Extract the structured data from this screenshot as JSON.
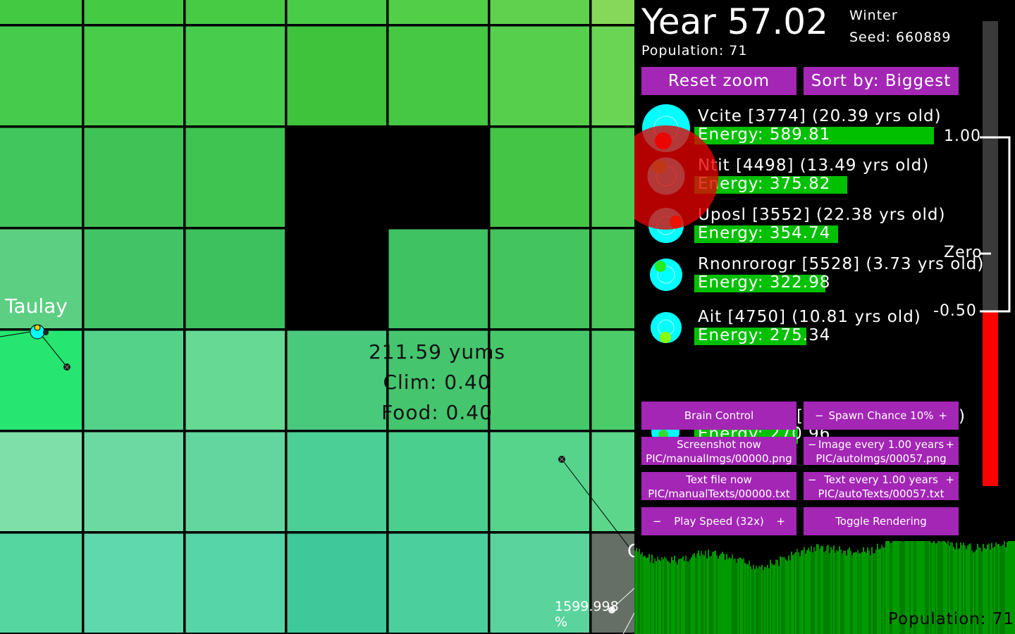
{
  "header": {
    "year_label": "Year 57.02",
    "season": "Winter",
    "seed_label": "Seed: 660889",
    "population_label": "Population: 71"
  },
  "controls": {
    "reset_zoom": "Reset zoom",
    "sort_by": "Sort by: Biggest"
  },
  "creatures": [
    {
      "name_line": "Vcite [3774] (20.39 yrs old)",
      "energy_line": "Energy: 589.81",
      "energy": 589.81,
      "mouth_color": "#ff1a00"
    },
    {
      "name_line": "Ntit [4498] (13.49 yrs old)",
      "energy_line": "Energy: 375.82",
      "energy": 375.82,
      "mouth_color": "#33ff66"
    },
    {
      "name_line": "Uposl [3552] (22.38 yrs old)",
      "energy_line": "Energy: 354.74",
      "energy": 354.74,
      "mouth_color": "#ff5500"
    },
    {
      "name_line": "Rnonrorogr [5528] (3.73 yrs old)",
      "energy_line": "Energy: 322.98",
      "energy": 322.98,
      "mouth_color": "#22ee22"
    },
    {
      "name_line": "Ait [4750] (10.81 yrs old)",
      "energy_line": "Energy: 275.34",
      "energy": 275.34,
      "mouth_color": "#88ff00"
    }
  ],
  "hidden_row": {
    "name_fragment": "[5",
    "name_tail": ")",
    "energy_line": "Energy: 270.96"
  },
  "buttons": {
    "brain_control": "Brain Control",
    "spawn_minus": "−",
    "spawn_label": "Spawn Chance 10%",
    "spawn_plus": "+",
    "screenshot_now": "Screenshot now",
    "screenshot_path": "PIC/manualImgs/00000.png",
    "image_minus": "−",
    "image_every": "Image every 1.00 years",
    "image_plus": "+",
    "image_path": "PIC/autoImgs/00057.png",
    "textfile_now": "Text file now",
    "textfile_path": "PIC/manualTexts/00000.txt",
    "text_minus": "−",
    "text_every": "Text every 1.00 years",
    "text_plus": "+",
    "text_path": "PIC/autoTexts/00057.txt",
    "speed_minus": "−",
    "speed_label": "Play Speed (32x)",
    "speed_plus": "+",
    "toggle_rendering": "Toggle Rendering"
  },
  "brain_scale": {
    "top_label": "1.00",
    "zero_label": "Zero",
    "low_label": "-0.50",
    "value": -0.5,
    "color_negative": "#ff0000"
  },
  "population_graph": {
    "label": "Population: 71",
    "color": "#008000"
  },
  "map": {
    "place_label": "Taulay",
    "edge_label": "C",
    "tile_yums": "211.59 yums",
    "tile_clim": "Clim: 0.40",
    "tile_food": "Food: 0.40",
    "scale_readout": "1599.998 %"
  },
  "colors": {
    "button": "#a326b5",
    "energy_bar": "#00c000",
    "creature_body": "#00ffff",
    "selection_highlight": "#e60000"
  }
}
